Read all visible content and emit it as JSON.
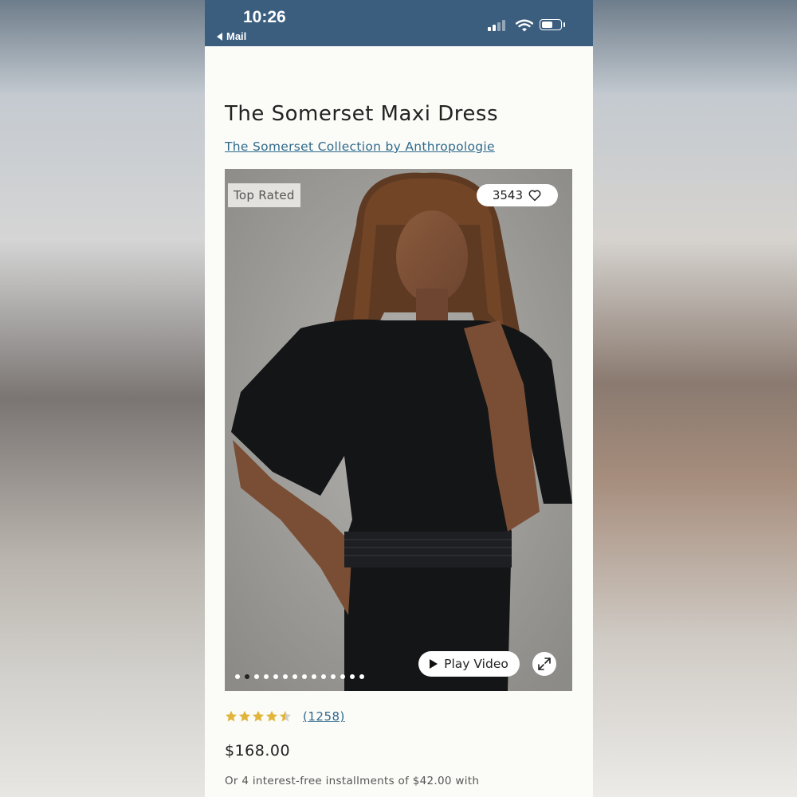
{
  "status_bar": {
    "time": "10:26",
    "back_label": "Mail",
    "background_color": "#3b5e7f"
  },
  "product": {
    "title": "The Somerset Maxi Dress",
    "collection_link": "The Somerset Collection by Anthropologie",
    "badge": "Top Rated",
    "likes": "3543",
    "video_button": "Play Video",
    "image_count": 14,
    "active_image_index": 1,
    "rating": 4.5,
    "reviews": "(1258)",
    "price": "$168.00",
    "installments": "Or 4 interest-free installments of $42.00 with",
    "link_color": "#2f6a8c",
    "star_color": "#e0b53a"
  }
}
